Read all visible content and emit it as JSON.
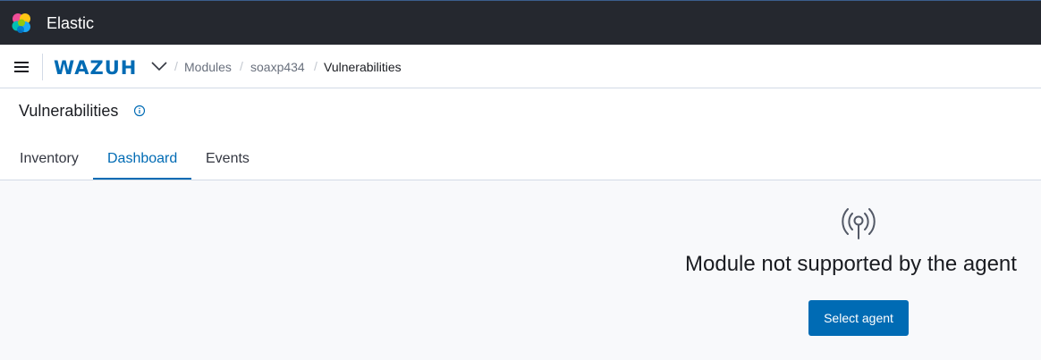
{
  "app": {
    "title": "Elastic"
  },
  "nav": {
    "brand": "WAZUH",
    "breadcrumbs": [
      "Modules",
      "soaxp434",
      "Vulnerabilities"
    ],
    "separator": "/"
  },
  "header": {
    "title": "Vulnerabilities",
    "tabs": [
      {
        "label": "Inventory",
        "active": false
      },
      {
        "label": "Dashboard",
        "active": true
      },
      {
        "label": "Events",
        "active": false
      }
    ]
  },
  "empty_state": {
    "icon": "antenna-icon",
    "title": "Module not supported by the agent",
    "button_label": "Select agent"
  },
  "colors": {
    "topbar": "#25282f",
    "accent": "#006bb4",
    "background": "#f8f9fb"
  }
}
